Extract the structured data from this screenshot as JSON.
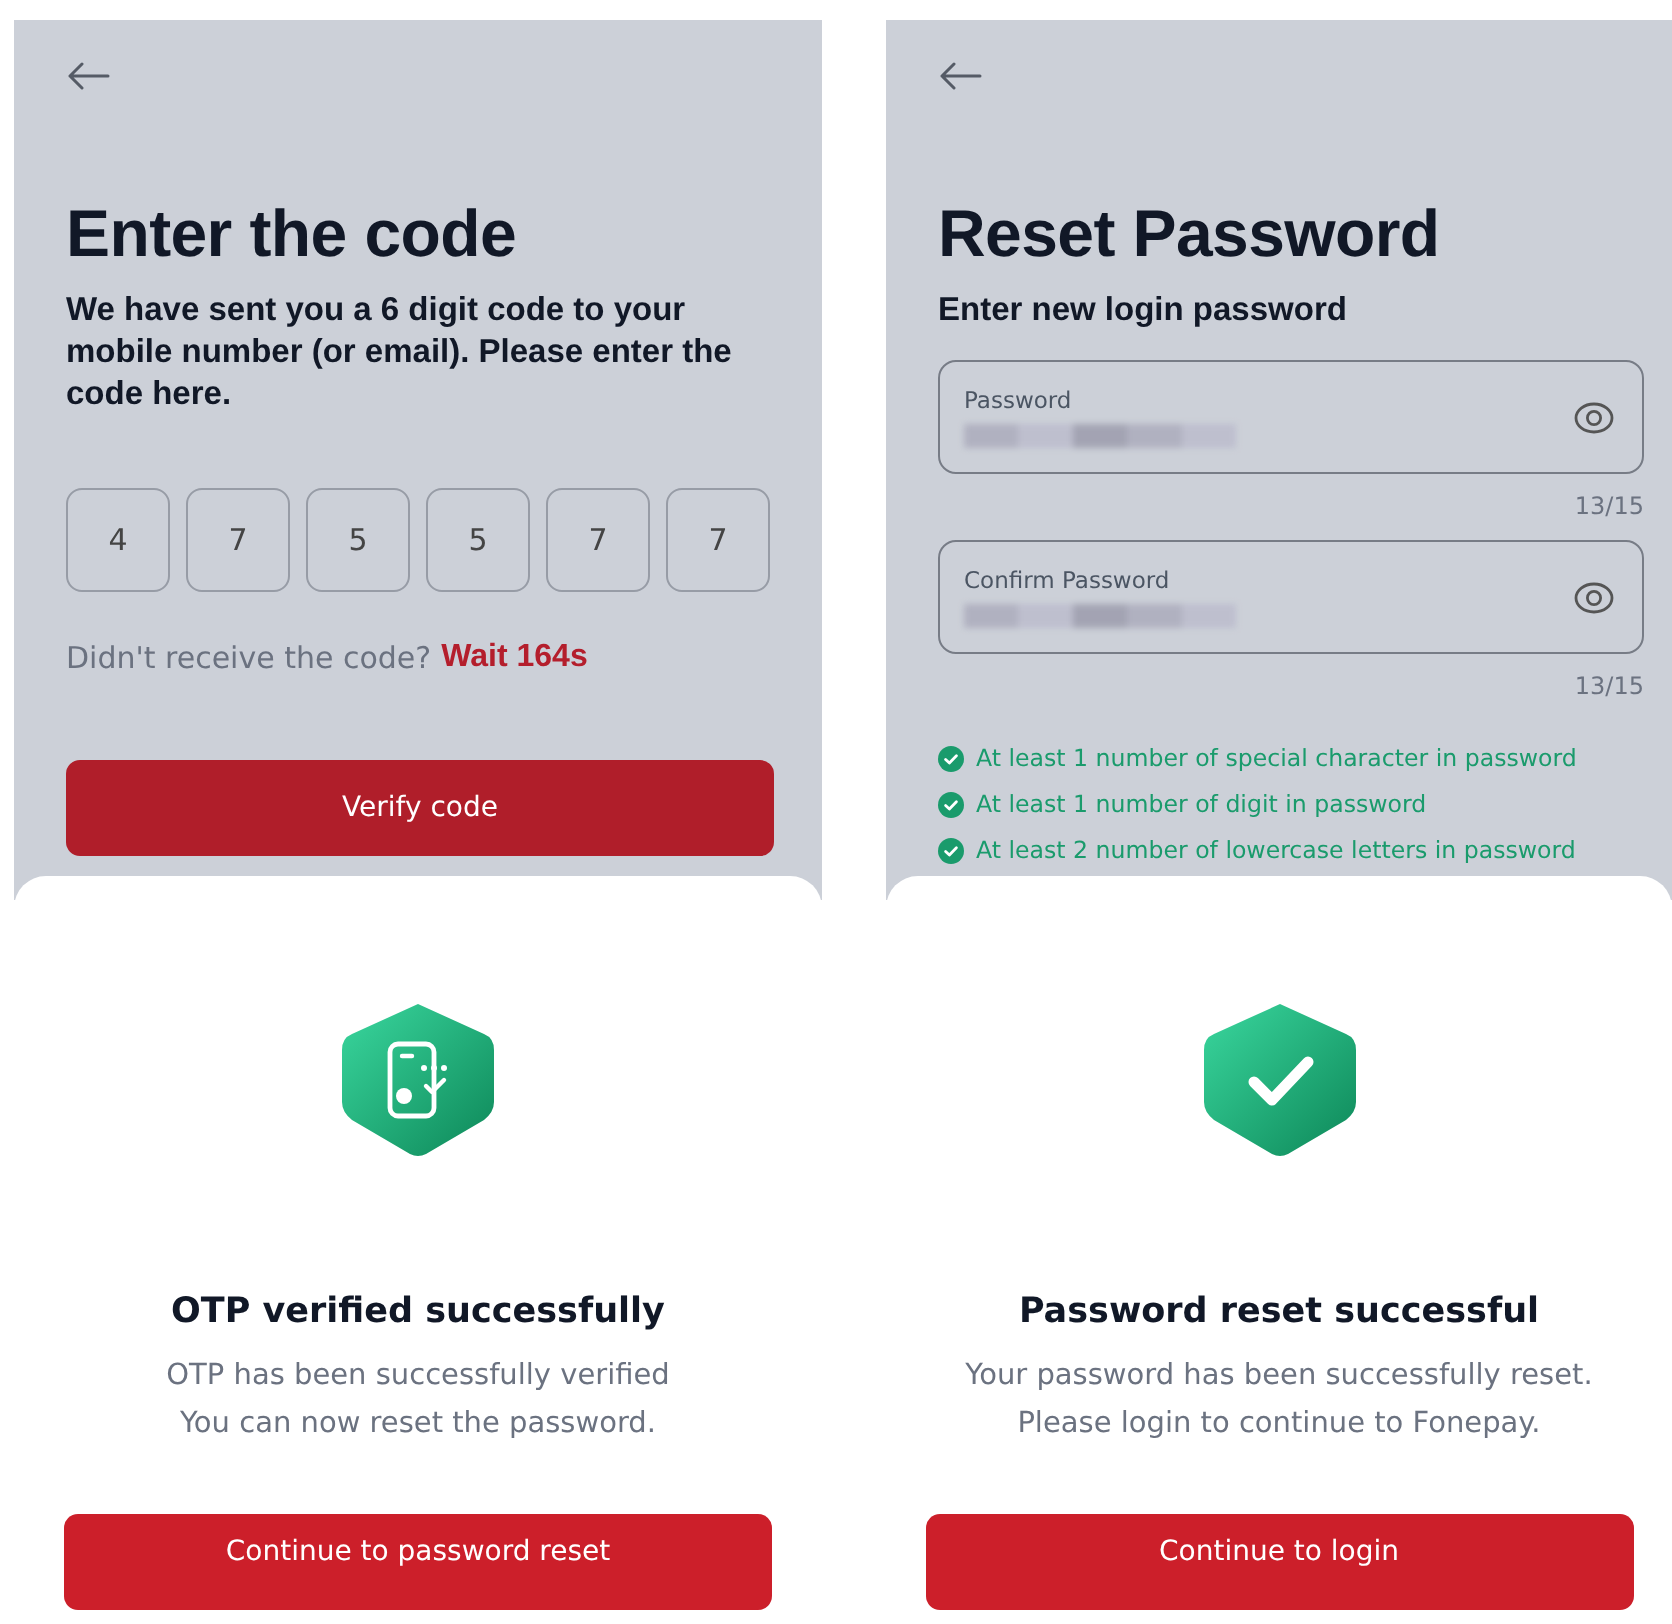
{
  "otp_screen": {
    "title": "Enter the code",
    "description": "We have sent you a 6 digit code to your mobile number (or email). Please enter the code here.",
    "digits": [
      "4",
      "7",
      "5",
      "5",
      "7",
      "7"
    ],
    "resend_prompt": "Didn't receive the code?",
    "resend_timer": "Wait 164s",
    "button": "Verify code"
  },
  "reset_screen": {
    "title": "Reset Password",
    "subtitle": "Enter new login password",
    "fields": [
      {
        "label": "Password",
        "counter": "13/15"
      },
      {
        "label": "Confirm Password",
        "counter": "13/15"
      }
    ],
    "requirements": [
      {
        "text": "At least 1 number of special character in password",
        "met": true
      },
      {
        "text": "At least 1 number of digit in password",
        "met": true
      },
      {
        "text": "At least 2 number of lowercase letters in password",
        "met": true
      }
    ]
  },
  "sheets": [
    {
      "kind": "otp",
      "title": "OTP verified successfully",
      "lines": [
        "OTP has been successfully verified",
        "You can now reset the password."
      ],
      "button": "Continue to password reset"
    },
    {
      "kind": "check",
      "title": "Password reset successful",
      "lines": [
        "Your password has been successfully reset.",
        "Please login to continue to Fonepay."
      ],
      "button": "Continue to login"
    }
  ]
}
